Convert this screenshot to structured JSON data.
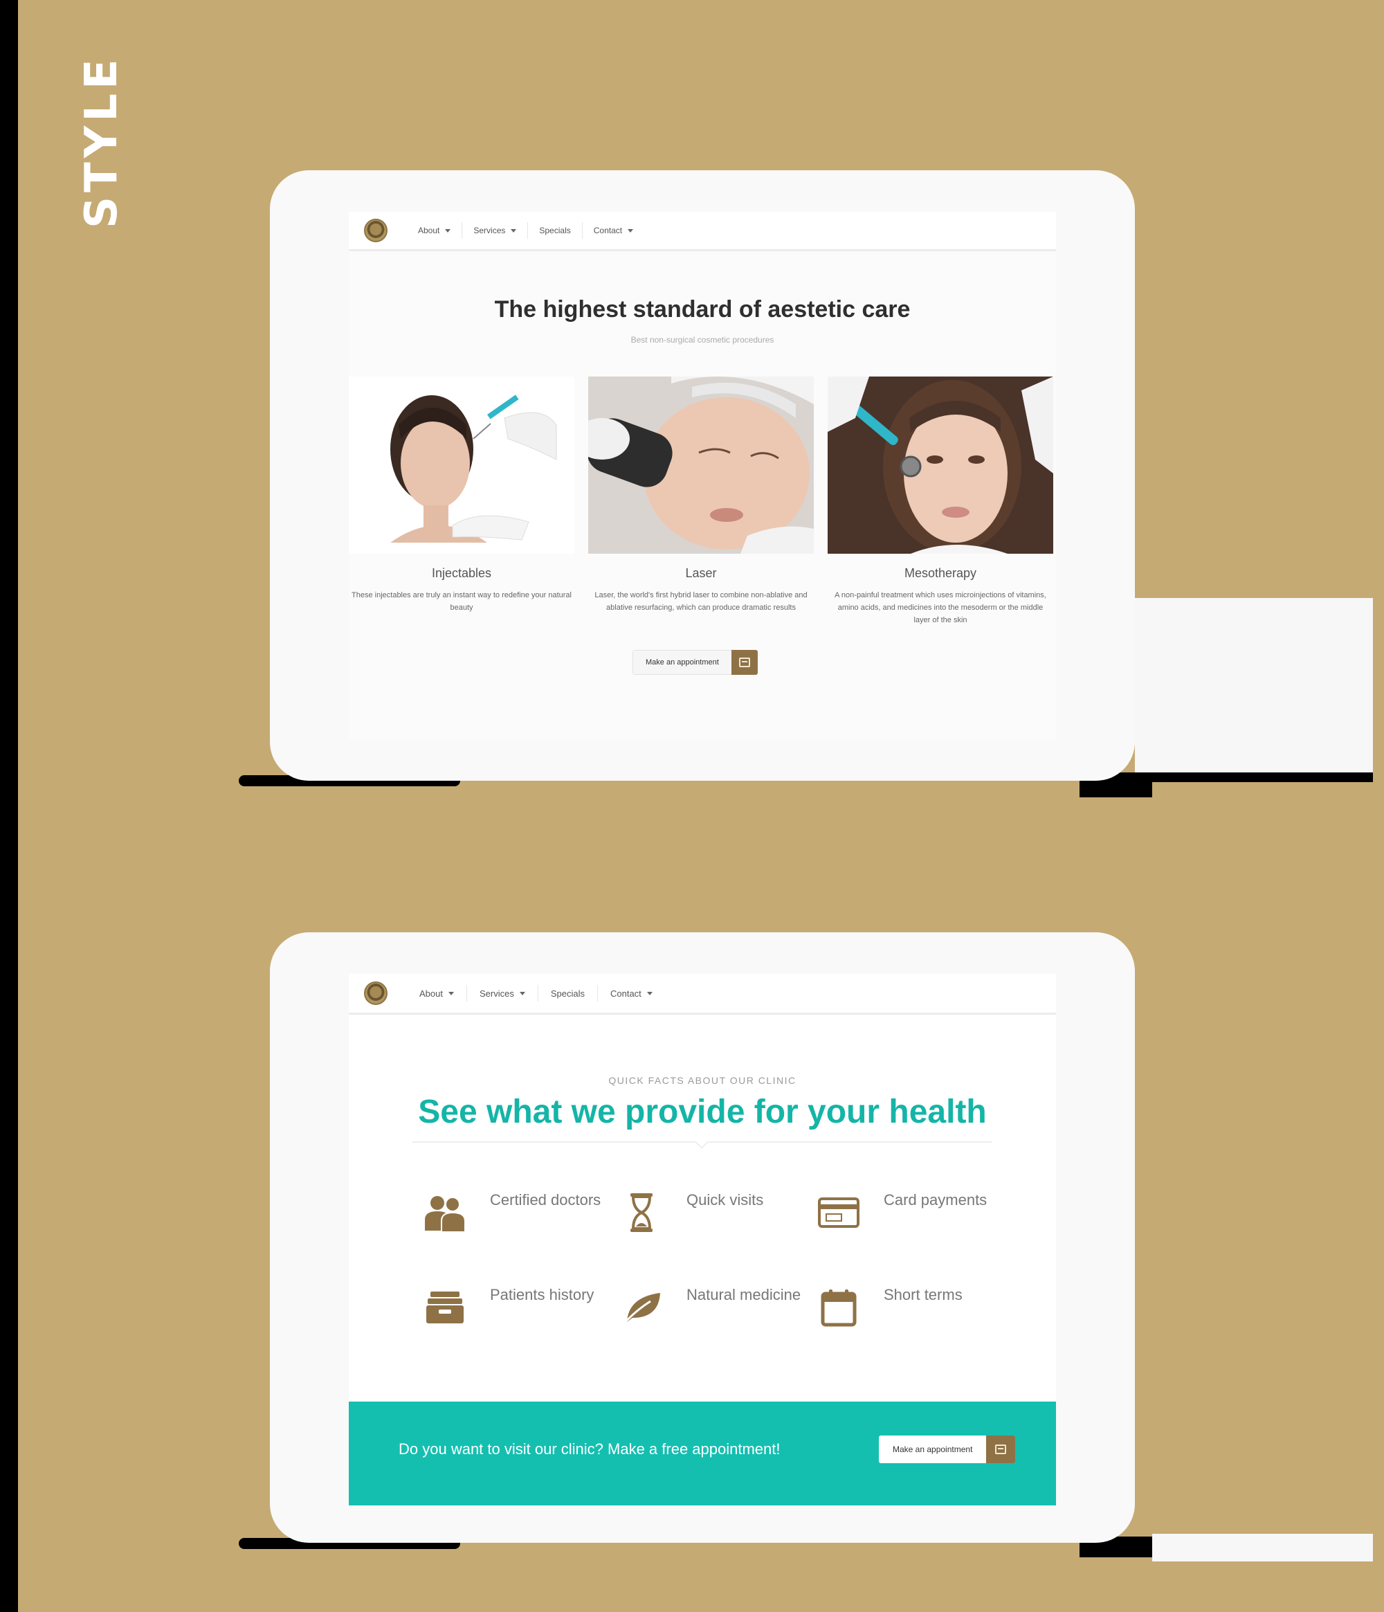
{
  "page": {
    "side_label": "STYLE"
  },
  "nav": {
    "items": [
      "About",
      "Services",
      "Specials",
      "Contact"
    ]
  },
  "section1": {
    "title": "The highest standard of aestetic care",
    "subtitle": "Best non-surgical cosmetic procedures",
    "cards": [
      {
        "title": "Injectables",
        "desc": "These injectables are truly an instant way to redefine your natural beauty"
      },
      {
        "title": "Laser",
        "desc": "Laser, the world's first hybrid laser to combine non-ablative and ablative resurfacing, which can produce dramatic results"
      },
      {
        "title": "Mesotherapy",
        "desc": "A non-painful treatment which uses microinjections of vitamins, amino acids, and medicines into the mesoderm or the middle layer of the skin"
      }
    ],
    "cta_label": "Make an appointment"
  },
  "section2": {
    "eyebrow": "QUICK FACTS ABOUT OUR CLINIC",
    "headline": "See what we provide for your health",
    "features": [
      {
        "label": "Certified doctors",
        "icon": "doctors-icon"
      },
      {
        "label": "Quick visits",
        "icon": "hourglass-icon"
      },
      {
        "label": "Card payments",
        "icon": "credit-card-icon"
      },
      {
        "label": "Patients history",
        "icon": "archive-box-icon"
      },
      {
        "label": "Natural medicine",
        "icon": "leaf-icon"
      },
      {
        "label": "Short terms",
        "icon": "calendar-icon"
      }
    ],
    "banner_text": "Do you want to visit our clinic? Make a free appointment!",
    "cta_label": "Make an appointment"
  },
  "colors": {
    "background": "#c6aa74",
    "accent": "#8e7246",
    "teal": "#14b5a7"
  }
}
